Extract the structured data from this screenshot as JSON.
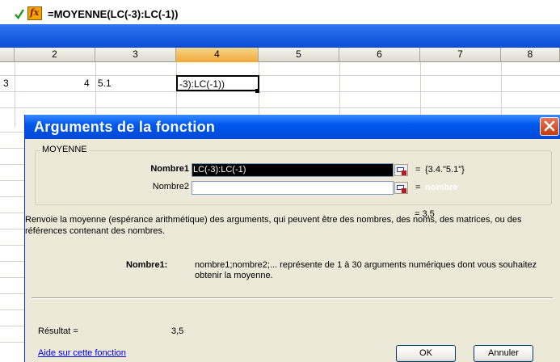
{
  "formula_bar": {
    "accept_icon": "check-icon",
    "function_icon": "fx-icon",
    "function_icon_text": "fx",
    "formula": "=MOYENNE(LC(-3):LC(-1))"
  },
  "grid": {
    "columns": [
      "2",
      "3",
      "4",
      "5",
      "6",
      "7",
      "8"
    ],
    "selected_column": "4",
    "row_partial_digit": "3",
    "cells": {
      "c2": "4",
      "c3": "5.1",
      "c4_editing": "-3):LC(-1))"
    }
  },
  "dialog": {
    "title": "Arguments de la fonction",
    "close_icon": "close-icon",
    "group_label": "MOYENNE",
    "args": [
      {
        "label": "Nombre1",
        "value": "LC(-3):LC(-1)",
        "equals": "=",
        "result": "{3.4.\"5.1\"}"
      },
      {
        "label": "Nombre2",
        "value": "",
        "equals": "=",
        "result": "nombre"
      }
    ],
    "result_top": "= 3,5",
    "description": "Renvoie la moyenne (espérance arithmétique) des arguments, qui peuvent être des nombres, des noms, des matrices, ou des références contenant des nombres.",
    "arg_desc_label": "Nombre1:",
    "arg_desc_text": "nombre1;nombre2;... représente de 1 à 30 arguments numériques dont vous souhaitez obtenir la moyenne.",
    "result_label": "Résultat =",
    "result_value": "3,5",
    "help_link": "Aide sur cette fonction",
    "ok_label": "OK",
    "cancel_label": "Annuler"
  },
  "colors": {
    "title_blue": "#0058ee",
    "selected_column": "#f0a838",
    "dialog_bg": "#ece9d8",
    "link": "#0000ee"
  }
}
